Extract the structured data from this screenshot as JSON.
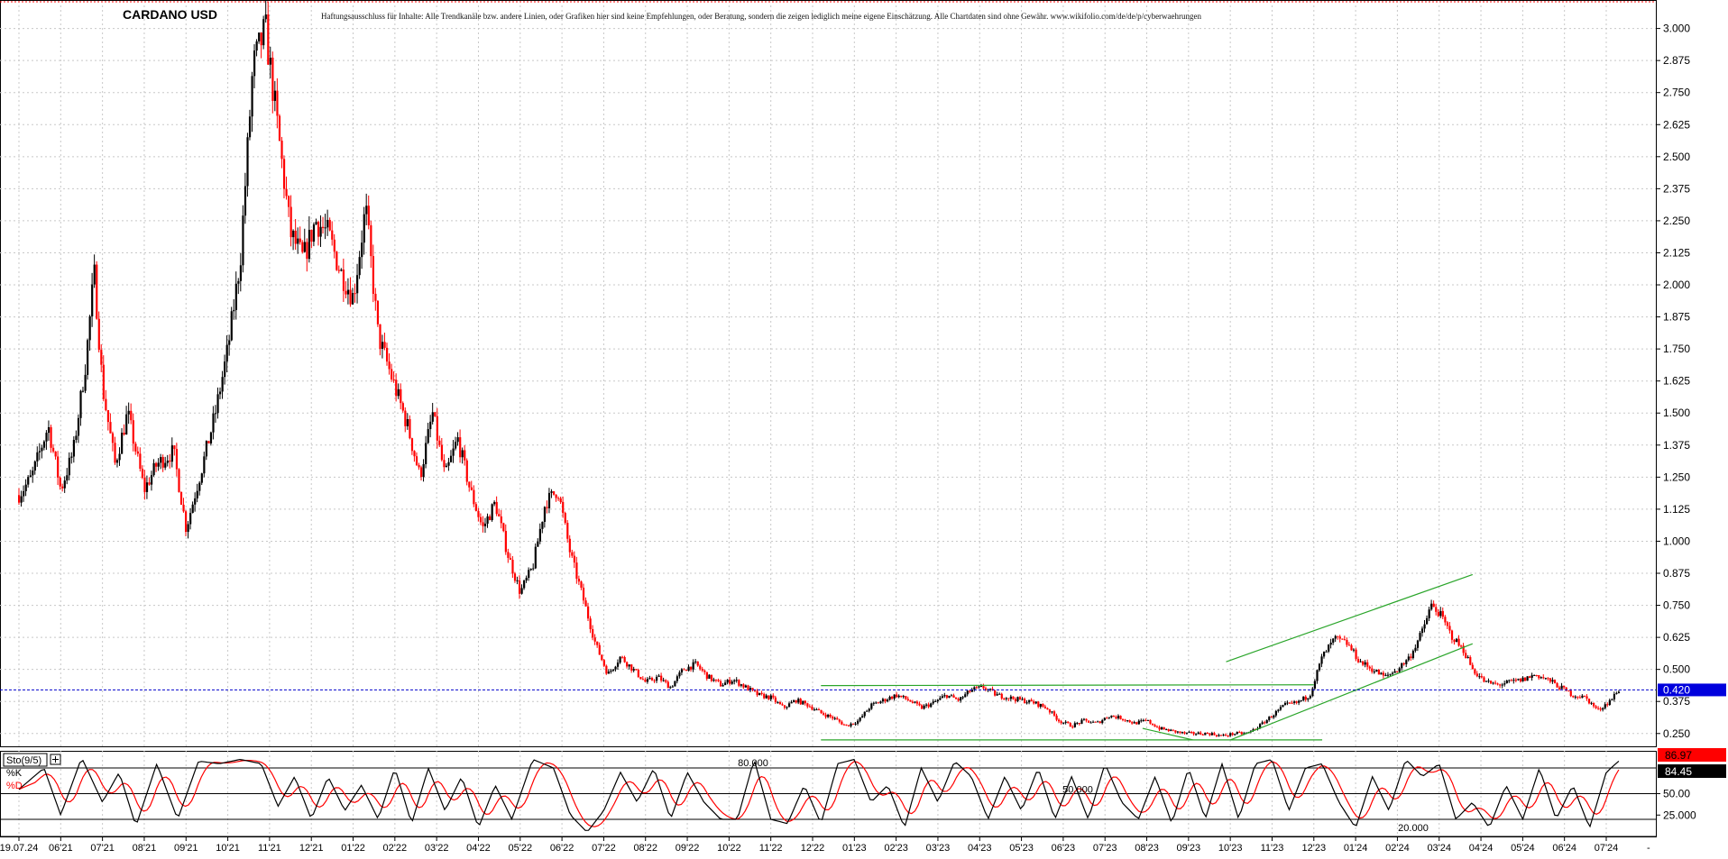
{
  "header": {
    "title": "CARDANO USD",
    "disclaimer": "Haftungsausschluss für Inhalte: Alle Trendkanäle bzw. andere Linien, oder Grafiken hier sind keine Empfehlungen, oder Beratung, sondern die zeigen lediglich meine eigene Einschätzung. Alle Chartdaten sind ohne Gewähr.  www.wikifolio.com/de/de/p/cyberwaehrungen"
  },
  "colors": {
    "up": "#000000",
    "down": "#ff0000",
    "grid": "#c8c8c8",
    "trend": "#2aa52a",
    "last_price_line": "#0000cc",
    "last_price_bg": "#0000dd",
    "k_line": "#000000",
    "d_line": "#ff0000",
    "k_bg": "#000000",
    "d_bg": "#ff0000"
  },
  "chart_data": [
    {
      "type": "candlestick",
      "title": "CARDANO USD",
      "x_labels": [
        "19.07.24",
        "06'21",
        "07'21",
        "08'21",
        "09'21",
        "10'21",
        "11'21",
        "12'21",
        "01'22",
        "02'22",
        "03'22",
        "04'22",
        "05'22",
        "06'22",
        "07'22",
        "08'22",
        "09'22",
        "10'22",
        "11'22",
        "12'22",
        "01'23",
        "02'23",
        "03'23",
        "04'23",
        "05'23",
        "06'23",
        "07'23",
        "08'23",
        "09'23",
        "10'23",
        "11'23",
        "12'23",
        "01'24",
        "02'24",
        "03'24",
        "04'24",
        "05'24",
        "06'24",
        "07'24"
      ],
      "y_ticks": [
        "3.000",
        "2.875",
        "2.750",
        "2.625",
        "2.500",
        "2.375",
        "2.250",
        "2.125",
        "2.000",
        "1.875",
        "1.750",
        "1.625",
        "1.500",
        "1.375",
        "1.250",
        "1.125",
        "1.000",
        "0.875",
        "0.750",
        "0.625",
        "0.500",
        "0.375",
        "0.250"
      ],
      "ylim": [
        0.2,
        3.09
      ],
      "last_price": "0.420",
      "anchors": [
        {
          "x": 0,
          "y": 1.18
        },
        {
          "x": 0.3,
          "y": 1.25
        },
        {
          "x": 0.7,
          "y": 1.45
        },
        {
          "x": 1.0,
          "y": 1.2
        },
        {
          "x": 1.3,
          "y": 1.35
        },
        {
          "x": 1.6,
          "y": 1.7
        },
        {
          "x": 1.8,
          "y": 2.05
        },
        {
          "x": 2.0,
          "y": 1.6
        },
        {
          "x": 2.3,
          "y": 1.3
        },
        {
          "x": 2.6,
          "y": 1.5
        },
        {
          "x": 3.0,
          "y": 1.2
        },
        {
          "x": 3.3,
          "y": 1.3
        },
        {
          "x": 3.7,
          "y": 1.35
        },
        {
          "x": 4.0,
          "y": 1.05
        },
        {
          "x": 4.4,
          "y": 1.3
        },
        {
          "x": 4.7,
          "y": 1.5
        },
        {
          "x": 5.0,
          "y": 1.75
        },
        {
          "x": 5.3,
          "y": 2.1
        },
        {
          "x": 5.6,
          "y": 2.85
        },
        {
          "x": 5.9,
          "y": 3.0
        },
        {
          "x": 6.2,
          "y": 2.6
        },
        {
          "x": 6.5,
          "y": 2.2
        },
        {
          "x": 6.8,
          "y": 2.1
        },
        {
          "x": 7.1,
          "y": 2.25
        },
        {
          "x": 7.4,
          "y": 2.2
        },
        {
          "x": 7.7,
          "y": 2.05
        },
        {
          "x": 8.0,
          "y": 1.95
        },
        {
          "x": 8.3,
          "y": 2.3
        },
        {
          "x": 8.6,
          "y": 1.8
        },
        {
          "x": 9.0,
          "y": 1.6
        },
        {
          "x": 9.3,
          "y": 1.45
        },
        {
          "x": 9.6,
          "y": 1.25
        },
        {
          "x": 9.9,
          "y": 1.5
        },
        {
          "x": 10.2,
          "y": 1.25
        },
        {
          "x": 10.5,
          "y": 1.4
        },
        {
          "x": 10.8,
          "y": 1.2
        },
        {
          "x": 11.1,
          "y": 1.05
        },
        {
          "x": 11.4,
          "y": 1.15
        },
        {
          "x": 11.7,
          "y": 0.95
        },
        {
          "x": 12.0,
          "y": 0.8
        },
        {
          "x": 12.3,
          "y": 0.9
        },
        {
          "x": 12.6,
          "y": 1.15
        },
        {
          "x": 12.9,
          "y": 1.2
        },
        {
          "x": 13.2,
          "y": 0.95
        },
        {
          "x": 13.5,
          "y": 0.78
        },
        {
          "x": 13.8,
          "y": 0.6
        },
        {
          "x": 14.1,
          "y": 0.48
        },
        {
          "x": 14.4,
          "y": 0.55
        },
        {
          "x": 14.7,
          "y": 0.5
        },
        {
          "x": 15.0,
          "y": 0.45
        },
        {
          "x": 15.3,
          "y": 0.47
        },
        {
          "x": 15.6,
          "y": 0.43
        },
        {
          "x": 15.9,
          "y": 0.5
        },
        {
          "x": 16.2,
          "y": 0.52
        },
        {
          "x": 16.5,
          "y": 0.47
        },
        {
          "x": 16.8,
          "y": 0.44
        },
        {
          "x": 17.1,
          "y": 0.46
        },
        {
          "x": 17.4,
          "y": 0.43
        },
        {
          "x": 17.7,
          "y": 0.4
        },
        {
          "x": 18.0,
          "y": 0.39
        },
        {
          "x": 18.3,
          "y": 0.35
        },
        {
          "x": 18.6,
          "y": 0.38
        },
        {
          "x": 18.9,
          "y": 0.36
        },
        {
          "x": 19.2,
          "y": 0.33
        },
        {
          "x": 19.5,
          "y": 0.31
        },
        {
          "x": 19.8,
          "y": 0.28
        },
        {
          "x": 20.1,
          "y": 0.3
        },
        {
          "x": 20.4,
          "y": 0.36
        },
        {
          "x": 20.7,
          "y": 0.38
        },
        {
          "x": 21.0,
          "y": 0.4
        },
        {
          "x": 21.3,
          "y": 0.38
        },
        {
          "x": 21.6,
          "y": 0.35
        },
        {
          "x": 21.9,
          "y": 0.37
        },
        {
          "x": 22.2,
          "y": 0.4
        },
        {
          "x": 22.5,
          "y": 0.38
        },
        {
          "x": 22.8,
          "y": 0.42
        },
        {
          "x": 23.1,
          "y": 0.43
        },
        {
          "x": 23.4,
          "y": 0.4
        },
        {
          "x": 23.7,
          "y": 0.39
        },
        {
          "x": 24.0,
          "y": 0.38
        },
        {
          "x": 24.3,
          "y": 0.37
        },
        {
          "x": 24.6,
          "y": 0.35
        },
        {
          "x": 24.9,
          "y": 0.3
        },
        {
          "x": 25.2,
          "y": 0.28
        },
        {
          "x": 25.5,
          "y": 0.3
        },
        {
          "x": 25.8,
          "y": 0.29
        },
        {
          "x": 26.1,
          "y": 0.32
        },
        {
          "x": 26.4,
          "y": 0.31
        },
        {
          "x": 26.7,
          "y": 0.29
        },
        {
          "x": 27.0,
          "y": 0.3
        },
        {
          "x": 27.3,
          "y": 0.27
        },
        {
          "x": 27.6,
          "y": 0.26
        },
        {
          "x": 27.9,
          "y": 0.25
        },
        {
          "x": 28.2,
          "y": 0.25
        },
        {
          "x": 28.5,
          "y": 0.25
        },
        {
          "x": 28.8,
          "y": 0.24
        },
        {
          "x": 29.1,
          "y": 0.25
        },
        {
          "x": 29.4,
          "y": 0.25
        },
        {
          "x": 29.7,
          "y": 0.28
        },
        {
          "x": 30.0,
          "y": 0.32
        },
        {
          "x": 30.3,
          "y": 0.36
        },
        {
          "x": 30.6,
          "y": 0.37
        },
        {
          "x": 30.9,
          "y": 0.4
        },
        {
          "x": 31.2,
          "y": 0.55
        },
        {
          "x": 31.5,
          "y": 0.62
        },
        {
          "x": 31.8,
          "y": 0.6
        },
        {
          "x": 32.1,
          "y": 0.53
        },
        {
          "x": 32.4,
          "y": 0.5
        },
        {
          "x": 32.7,
          "y": 0.47
        },
        {
          "x": 33.0,
          "y": 0.5
        },
        {
          "x": 33.3,
          "y": 0.55
        },
        {
          "x": 33.6,
          "y": 0.65
        },
        {
          "x": 33.8,
          "y": 0.75
        },
        {
          "x": 34.0,
          "y": 0.72
        },
        {
          "x": 34.3,
          "y": 0.63
        },
        {
          "x": 34.6,
          "y": 0.57
        },
        {
          "x": 34.8,
          "y": 0.5
        },
        {
          "x": 35.1,
          "y": 0.45
        },
        {
          "x": 35.4,
          "y": 0.44
        },
        {
          "x": 35.7,
          "y": 0.45
        },
        {
          "x": 36.0,
          "y": 0.46
        },
        {
          "x": 36.3,
          "y": 0.48
        },
        {
          "x": 36.6,
          "y": 0.46
        },
        {
          "x": 36.9,
          "y": 0.43
        },
        {
          "x": 37.2,
          "y": 0.4
        },
        {
          "x": 37.5,
          "y": 0.39
        },
        {
          "x": 37.8,
          "y": 0.34
        },
        {
          "x": 38.1,
          "y": 0.38
        },
        {
          "x": 38.3,
          "y": 0.42
        }
      ],
      "trendlines": [
        {
          "from": {
            "x": 19.2,
            "y": 0.437
          },
          "to": {
            "x": 31.0,
            "y": 0.44
          }
        },
        {
          "from": {
            "x": 19.2,
            "y": 0.225
          },
          "to": {
            "x": 31.2,
            "y": 0.225
          }
        },
        {
          "from": {
            "x": 26.9,
            "y": 0.27
          },
          "to": {
            "x": 28.1,
            "y": 0.225
          }
        },
        {
          "from": {
            "x": 29.0,
            "y": 0.225
          },
          "to": {
            "x": 34.8,
            "y": 0.6
          }
        },
        {
          "from": {
            "x": 28.9,
            "y": 0.53
          },
          "to": {
            "x": 34.8,
            "y": 0.87
          }
        }
      ]
    },
    {
      "type": "line",
      "title": "Sto(9/5)",
      "series": [
        {
          "name": "%K"
        },
        {
          "name": "%D"
        }
      ],
      "ylim": [
        0,
        100
      ],
      "y_ticks": [
        "50.00",
        "25.000"
      ],
      "levels": [
        {
          "value": 80,
          "label": "80.000"
        },
        {
          "value": 50,
          "label": "50.000"
        },
        {
          "value": 20,
          "label": "20.000"
        }
      ],
      "last_k": "86.97",
      "last_d": "84.45",
      "k_anchors": [
        {
          "x": 0,
          "y": 55
        },
        {
          "x": 0.6,
          "y": 80
        },
        {
          "x": 1.0,
          "y": 25
        },
        {
          "x": 1.5,
          "y": 92
        },
        {
          "x": 2.0,
          "y": 40
        },
        {
          "x": 2.4,
          "y": 75
        },
        {
          "x": 2.8,
          "y": 12
        },
        {
          "x": 3.3,
          "y": 85
        },
        {
          "x": 3.8,
          "y": 20
        },
        {
          "x": 4.3,
          "y": 88
        },
        {
          "x": 4.8,
          "y": 85
        },
        {
          "x": 5.3,
          "y": 90
        },
        {
          "x": 5.8,
          "y": 85
        },
        {
          "x": 6.2,
          "y": 35
        },
        {
          "x": 6.6,
          "y": 70
        },
        {
          "x": 7.0,
          "y": 20
        },
        {
          "x": 7.4,
          "y": 70
        },
        {
          "x": 7.8,
          "y": 30
        },
        {
          "x": 8.2,
          "y": 60
        },
        {
          "x": 8.6,
          "y": 20
        },
        {
          "x": 9.0,
          "y": 80
        },
        {
          "x": 9.4,
          "y": 15
        },
        {
          "x": 9.8,
          "y": 80
        },
        {
          "x": 10.2,
          "y": 30
        },
        {
          "x": 10.6,
          "y": 70
        },
        {
          "x": 11.0,
          "y": 10
        },
        {
          "x": 11.4,
          "y": 60
        },
        {
          "x": 11.8,
          "y": 20
        },
        {
          "x": 12.3,
          "y": 90
        },
        {
          "x": 12.8,
          "y": 80
        },
        {
          "x": 13.2,
          "y": 25
        },
        {
          "x": 13.6,
          "y": 5
        },
        {
          "x": 14.0,
          "y": 30
        },
        {
          "x": 14.4,
          "y": 75
        },
        {
          "x": 14.8,
          "y": 40
        },
        {
          "x": 15.2,
          "y": 80
        },
        {
          "x": 15.6,
          "y": 20
        },
        {
          "x": 16.0,
          "y": 75
        },
        {
          "x": 16.4,
          "y": 40
        },
        {
          "x": 16.8,
          "y": 20
        },
        {
          "x": 17.2,
          "y": 20
        },
        {
          "x": 17.6,
          "y": 90
        },
        {
          "x": 18.0,
          "y": 20
        },
        {
          "x": 18.4,
          "y": 15
        },
        {
          "x": 18.8,
          "y": 60
        },
        {
          "x": 19.2,
          "y": 15
        },
        {
          "x": 19.6,
          "y": 85
        },
        {
          "x": 20.0,
          "y": 90
        },
        {
          "x": 20.4,
          "y": 40
        },
        {
          "x": 20.8,
          "y": 60
        },
        {
          "x": 21.2,
          "y": 10
        },
        {
          "x": 21.6,
          "y": 80
        },
        {
          "x": 22.0,
          "y": 40
        },
        {
          "x": 22.4,
          "y": 88
        },
        {
          "x": 22.8,
          "y": 70
        },
        {
          "x": 23.2,
          "y": 20
        },
        {
          "x": 23.6,
          "y": 70
        },
        {
          "x": 24.0,
          "y": 30
        },
        {
          "x": 24.4,
          "y": 80
        },
        {
          "x": 24.8,
          "y": 20
        },
        {
          "x": 25.2,
          "y": 70
        },
        {
          "x": 25.6,
          "y": 20
        },
        {
          "x": 26.0,
          "y": 85
        },
        {
          "x": 26.4,
          "y": 40
        },
        {
          "x": 26.8,
          "y": 20
        },
        {
          "x": 27.2,
          "y": 70
        },
        {
          "x": 27.6,
          "y": 15
        },
        {
          "x": 28.0,
          "y": 80
        },
        {
          "x": 28.4,
          "y": 20
        },
        {
          "x": 28.8,
          "y": 85
        },
        {
          "x": 29.2,
          "y": 20
        },
        {
          "x": 29.6,
          "y": 85
        },
        {
          "x": 30.0,
          "y": 90
        },
        {
          "x": 30.4,
          "y": 30
        },
        {
          "x": 30.8,
          "y": 80
        },
        {
          "x": 31.2,
          "y": 85
        },
        {
          "x": 31.6,
          "y": 40
        },
        {
          "x": 32.0,
          "y": 10
        },
        {
          "x": 32.4,
          "y": 70
        },
        {
          "x": 32.8,
          "y": 30
        },
        {
          "x": 33.2,
          "y": 90
        },
        {
          "x": 33.6,
          "y": 70
        },
        {
          "x": 34.0,
          "y": 85
        },
        {
          "x": 34.4,
          "y": 20
        },
        {
          "x": 34.8,
          "y": 40
        },
        {
          "x": 35.2,
          "y": 10
        },
        {
          "x": 35.6,
          "y": 60
        },
        {
          "x": 36.0,
          "y": 20
        },
        {
          "x": 36.4,
          "y": 80
        },
        {
          "x": 36.8,
          "y": 20
        },
        {
          "x": 37.2,
          "y": 60
        },
        {
          "x": 37.6,
          "y": 10
        },
        {
          "x": 38.0,
          "y": 75
        },
        {
          "x": 38.3,
          "y": 88
        }
      ]
    }
  ]
}
